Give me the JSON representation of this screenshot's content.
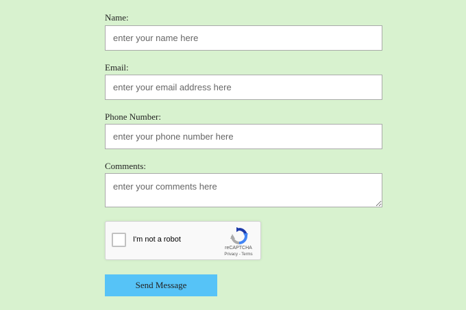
{
  "form": {
    "name": {
      "label": "Name:",
      "placeholder": "enter your name here"
    },
    "email": {
      "label": "Email:",
      "placeholder": "enter your email address here"
    },
    "phone": {
      "label": "Phone Number:",
      "placeholder": "enter your phone number here"
    },
    "comments": {
      "label": "Comments:",
      "placeholder": "enter your comments here"
    }
  },
  "recaptcha": {
    "label": "I'm not a robot",
    "brand": "reCAPTCHA",
    "privacy": "Privacy",
    "separator": " - ",
    "terms": "Terms",
    "logo_icon": "recaptcha-logo-icon"
  },
  "submit": {
    "label": "Send Message"
  },
  "colors": {
    "background": "#d8f2cf",
    "button": "#56c3f7"
  }
}
